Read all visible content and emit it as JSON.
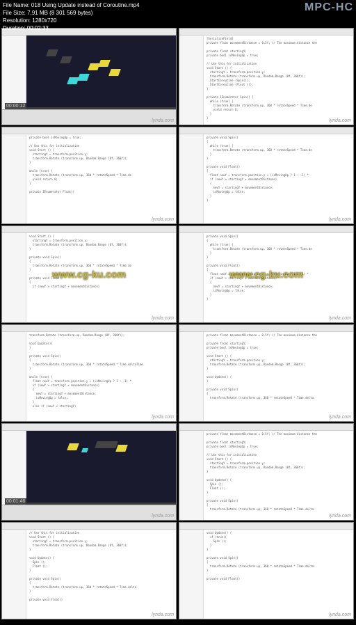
{
  "player": {
    "app_name": "MPC-HC",
    "file_name_label": "File Name:",
    "file_name": "018 Using Update instead of Coroutine.mp4",
    "file_size_label": "File Size:",
    "file_size": "7,91 MB (8 301 569 bytes)",
    "resolution_label": "Resolution:",
    "resolution": "1280x720",
    "duration_label": "Duration:",
    "duration": "00:02:33"
  },
  "watermark": {
    "source": "lynda.com",
    "domain": "www.cg-ku.com"
  },
  "timestamps": [
    "00:00:12",
    "",
    "",
    "",
    "",
    "",
    "",
    "",
    "",
    "00:01:46",
    "",
    ""
  ],
  "code_snippets": {
    "a": "[SerializeField]\nprivate float movementDistance = 0.5f; // The maximum distance the\n\nprivate float startingY;\nprivate bool isMovingUp = true;\n\n// Use this for initialization\nvoid Start () {\n  startingY = transform.position.y;\n  transform.Rotate (transform.up, Random.Range (0f, 360f));\n  StartCoroutine (Spin());\n  StartCoroutine (Float ());\n}\n\nprivate IEnumerator Spin() {\n  while (true) {\n    transform.Rotate (transform.up, 360 * rotateSpeed * Time.de\n    yield return 0;\n  }\n}",
    "b": "private bool isMovingUp = true;\n\n// Use this for initialization\nvoid Start () {\n  startingY = transform.position.y;\n  transform.Rotate (transform.up, Random.Range (0f, 360f));\n}\n\nwhile (true) {\n  transform.Rotate (transform.up, 360 * rotateSpeed * Time.de\n  yield return 0;\n}\n\nprivate IEnumerator Float()",
    "c": "private void Spin()\n{\n  while (true) {\n    transform.Rotate (transform.up, 360 * rotateSpeed * Time.de\n  }\n}\n\nprivate void Float()\n{\n  float newY = transform.position.y + (isMovingUp ? 1 : -1) *\n  if (newY > startingY + movementDistance)\n  {\n    newY = startingY + movementDistance;\n    isMovingUp = false;\n  }\n}",
    "d": "void Start () {\n  startingY = transform.position.y;\n  transform.Rotate (transform.up, Random.Range (0f, 360f));\n}\n\nprivate void Spin()\n{\n  transform.Rotate (transform.up, 360 * rotateSpeed * Time.de\n}\n\nprivate void Float()\n{\n  if (newY > startingY + movementDistance)",
    "e": "transform.Rotate (transform.up, Random.Range (0f, 360f));\n\nvoid Update(){\n}\n\nprivate void Spin()\n{\n  transform.Rotate (transform.up, 360 * rotateSpeed * Time.deltaTime\n}\n\nwhile (true) {\n  float newY = transform.position.y + (isMovingUp ? 1 : -1) *\n  if (newY > startingY + movementDistance)\n  {\n    newY = startingY + movementDistance;\n    isMovingUp = false;\n  }\n  else if (newY < startingY)",
    "f": "private float movementDistance = 0.5f; // The maximum distance the\n\nprivate float startingY;\nprivate bool isMovingUp = true;\n\nvoid Start () {\n  startingY = transform.position.y;\n  transform.Rotate (transform.up, Random.Range (0f, 360f));\n}\n\nvoid Update() {\n}\n\nprivate void Spin()\n{\n  transform.Rotate (transform.up, 360 * rotateSpeed * Time.delta",
    "g": "private float movementDistance = 0.5f; // The maximum distance the\n\nprivate float startingY;\nprivate bool isMovingUp = true;\n\n// Use this for initialization\nvoid Start () {\n  startingY = transform.position.y;\n  transform.Rotate (transform.up, Random.Range (0f, 360f));\n}\n\nvoid Update() {\n  Spin ();\n  Float ();\n}\n\nprivate void Spin()\n{\n  transform.Rotate (transform.up, 360 * rotateSpeed * Time.delta",
    "h": "// Use this for initialization\nvoid Start () {\n  startingY = transform.position.y;\n  transform.Rotate (transform.up, Random.Range (0f, 360f));\n}\n\nvoid Update() {\n  Spin ();\n  Float ();\n}\n\nprivate void Spin()\n{\n  transform.Rotate (transform.up, 360 * rotateSpeed * Time.delta\n}\n\nprivate void Float()",
    "i": "void Update() {\n  if (true){\n    Spin ();\n  }\n}\n\nprivate void Spin()\n{\n  transform.Rotate (transform.up, 360 * rotateSpeed * Time.delta\n}\n\nprivate void Float()"
  }
}
